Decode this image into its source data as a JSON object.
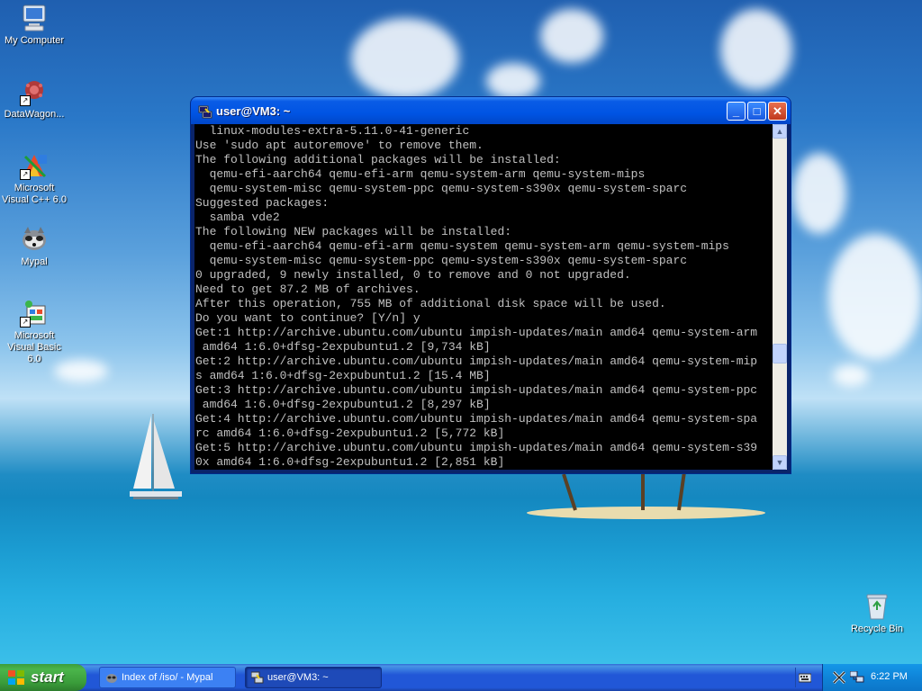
{
  "desktop_icons": [
    {
      "label": "My Computer",
      "icon": "my-computer-icon"
    },
    {
      "label": "DataWagon...",
      "icon": "datawagon-icon"
    },
    {
      "label": "Microsoft Visual C++ 6.0",
      "icon": "visual-cpp-icon"
    },
    {
      "label": "Mypal",
      "icon": "mypal-icon"
    },
    {
      "label": "Microsoft Visual Basic 6.0",
      "icon": "visual-basic-icon"
    },
    {
      "label": "Recycle Bin",
      "icon": "recycle-bin-icon"
    }
  ],
  "window": {
    "title": "user@VM3: ~",
    "icon": "putty-icon",
    "controls": {
      "minimize": "_",
      "maximize": "□",
      "close": "✕"
    }
  },
  "terminal": {
    "lines": [
      "  linux-modules-extra-5.11.0-41-generic",
      "Use 'sudo apt autoremove' to remove them.",
      "The following additional packages will be installed:",
      "  qemu-efi-aarch64 qemu-efi-arm qemu-system-arm qemu-system-mips",
      "  qemu-system-misc qemu-system-ppc qemu-system-s390x qemu-system-sparc",
      "Suggested packages:",
      "  samba vde2",
      "The following NEW packages will be installed:",
      "  qemu-efi-aarch64 qemu-efi-arm qemu-system qemu-system-arm qemu-system-mips",
      "  qemu-system-misc qemu-system-ppc qemu-system-s390x qemu-system-sparc",
      "0 upgraded, 9 newly installed, 0 to remove and 0 not upgraded.",
      "Need to get 87.2 MB of archives.",
      "After this operation, 755 MB of additional disk space will be used.",
      "Do you want to continue? [Y/n] y",
      "Get:1 http://archive.ubuntu.com/ubuntu impish-updates/main amd64 qemu-system-arm",
      " amd64 1:6.0+dfsg-2expubuntu1.2 [9,734 kB]",
      "Get:2 http://archive.ubuntu.com/ubuntu impish-updates/main amd64 qemu-system-mip",
      "s amd64 1:6.0+dfsg-2expubuntu1.2 [15.4 MB]",
      "Get:3 http://archive.ubuntu.com/ubuntu impish-updates/main amd64 qemu-system-ppc",
      " amd64 1:6.0+dfsg-2expubuntu1.2 [8,297 kB]",
      "Get:4 http://archive.ubuntu.com/ubuntu impish-updates/main amd64 qemu-system-spa",
      "rc amd64 1:6.0+dfsg-2expubuntu1.2 [5,772 kB]",
      "Get:5 http://archive.ubuntu.com/ubuntu impish-updates/main amd64 qemu-system-s39",
      "0x amd64 1:6.0+dfsg-2expubuntu1.2 [2,851 kB]"
    ]
  },
  "taskbar": {
    "start_label": "start",
    "tasks": [
      {
        "label": "Index of /iso/ - Mypal",
        "icon": "mypal-icon",
        "active": false
      },
      {
        "label": "user@VM3: ~",
        "icon": "putty-icon",
        "active": true
      }
    ],
    "tray_icons": [
      "keyboard-icon",
      "x-server-icon",
      "network-icon"
    ],
    "clock": "6:22 PM"
  }
}
